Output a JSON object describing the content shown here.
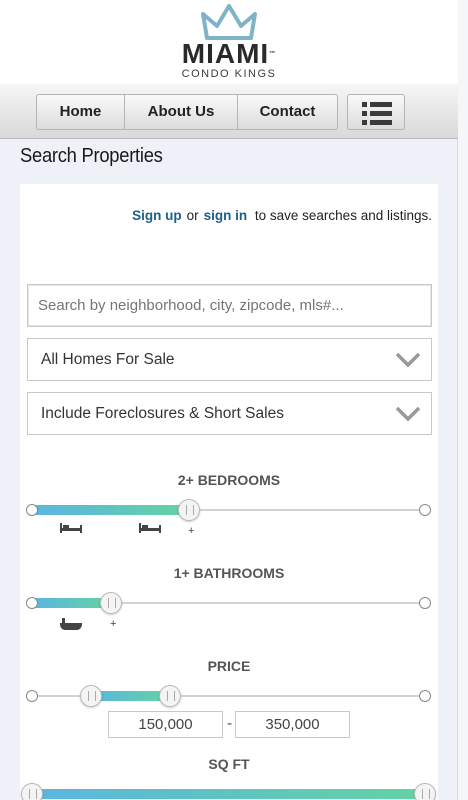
{
  "header": {
    "logo_main": "MIAMI",
    "logo_tm": "™",
    "logo_sub": "CONDO KINGS",
    "logo_icon": "crown-icon"
  },
  "nav": {
    "items": [
      {
        "label": "Home"
      },
      {
        "label": "About Us"
      },
      {
        "label": "Contact"
      }
    ],
    "menu_icon": "hamburger-menu-icon"
  },
  "search": {
    "title": "Search Properties",
    "signup_link": "Sign up",
    "or_text": "or",
    "signin_link": "sign in",
    "save_text": "to save searches and listings.",
    "placeholder": "Search by neighborhood, city, zipcode, mls#...",
    "home_type": "All Homes For Sale",
    "foreclosure_option": "Include Foreclosures & Short Sales"
  },
  "filters": {
    "bedrooms": {
      "label": "2+ BEDROOMS",
      "value_fraction": 0.4,
      "plus": "+"
    },
    "bathrooms": {
      "label": "1+ BATHROOMS",
      "value_fraction": 0.2,
      "plus": "+"
    },
    "price": {
      "label": "PRICE",
      "min": "150,000",
      "max": "350,000",
      "separator": "-",
      "min_fraction": 0.15,
      "max_fraction": 0.35
    },
    "sqft": {
      "label": "SQ FT",
      "min_fraction": 0.0,
      "max_fraction": 1.0
    }
  },
  "colors": {
    "link": "#1f5f86",
    "slider_start": "#5bb5e0",
    "slider_end": "#63d3a3",
    "crown": "#7fb3c8"
  }
}
